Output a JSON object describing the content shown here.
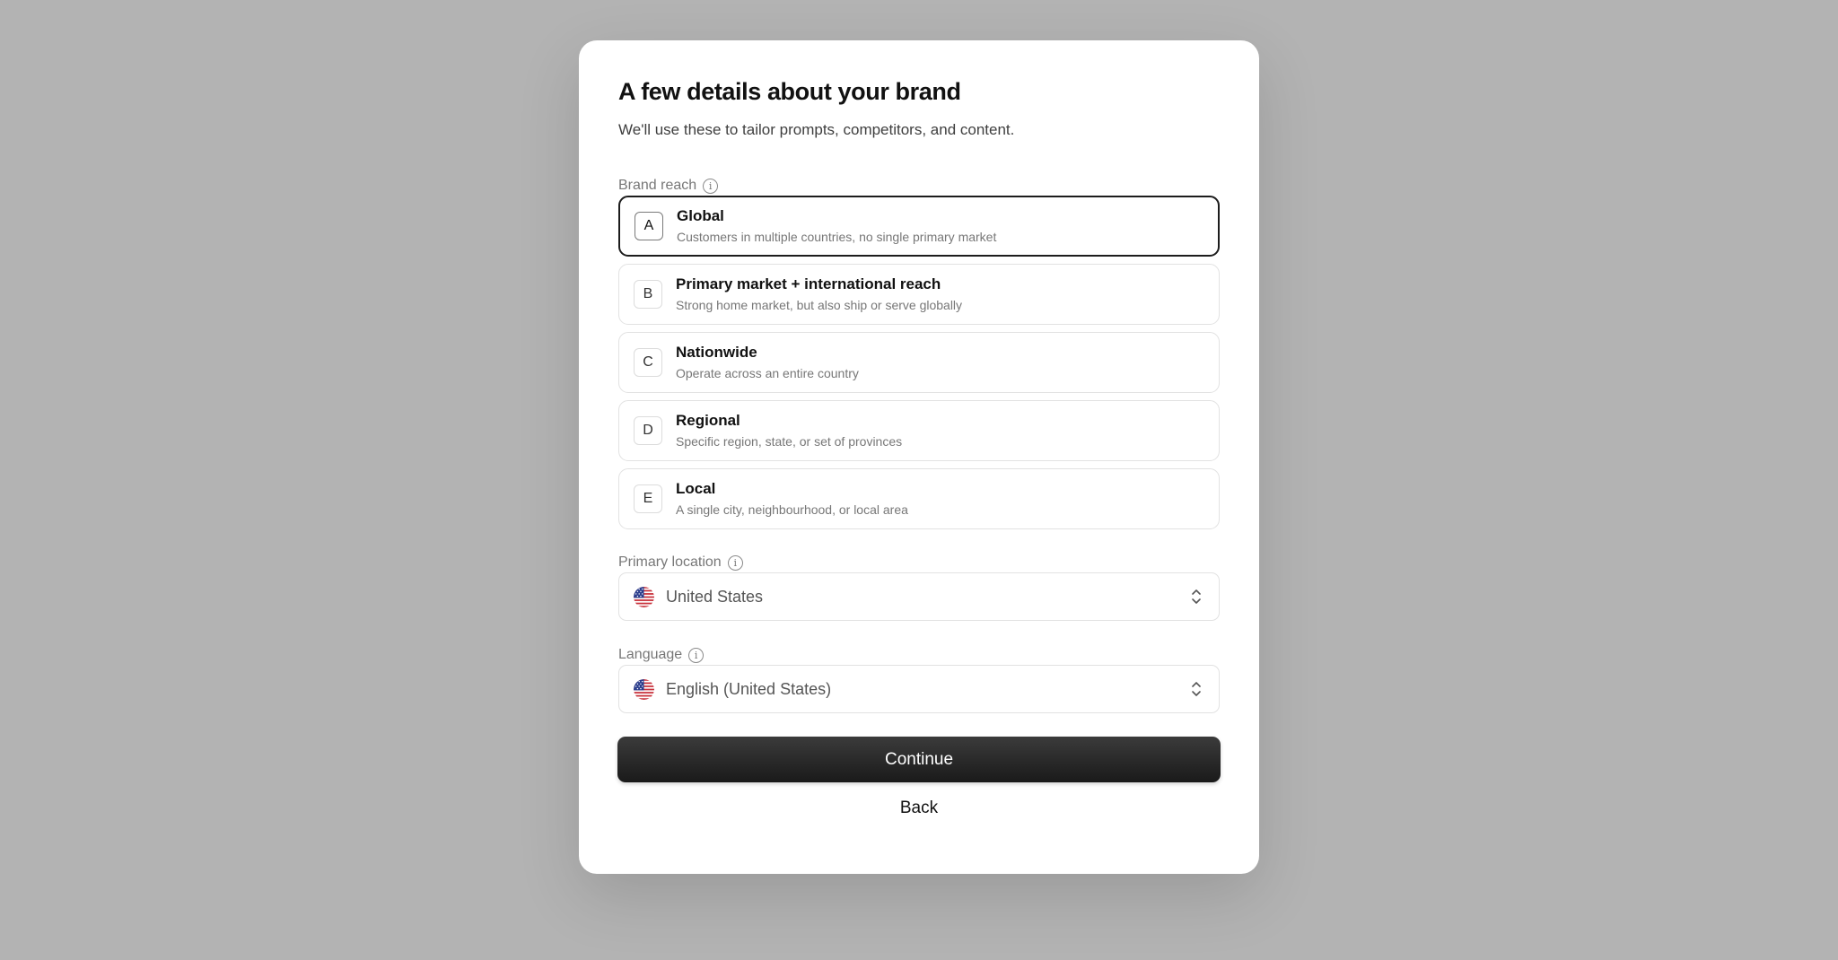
{
  "title": "A few details about your brand",
  "subtitle": "We'll use these to tailor prompts, competitors, and content.",
  "brand_reach": {
    "label": "Brand reach",
    "selected": "A",
    "options": [
      {
        "letter": "A",
        "title": "Global",
        "description": "Customers in multiple countries, no single primary market"
      },
      {
        "letter": "B",
        "title": "Primary market + international reach",
        "description": "Strong home market, but also ship or serve globally"
      },
      {
        "letter": "C",
        "title": "Nationwide",
        "description": "Operate across an entire country"
      },
      {
        "letter": "D",
        "title": "Regional",
        "description": "Specific region, state, or set of provinces"
      },
      {
        "letter": "E",
        "title": "Local",
        "description": "A single city, neighbourhood, or local area"
      }
    ]
  },
  "primary_location": {
    "label": "Primary location",
    "value": "United States",
    "flag_icon": "us-flag-icon"
  },
  "language": {
    "label": "Language",
    "value": "English (United States)",
    "flag_icon": "us-flag-icon"
  },
  "actions": {
    "continue_label": "Continue",
    "back_label": "Back"
  },
  "colors": {
    "overlay": "#b3b3b3",
    "primary_button": "#1f1f1f",
    "selected_border": "#1c1c1c"
  }
}
